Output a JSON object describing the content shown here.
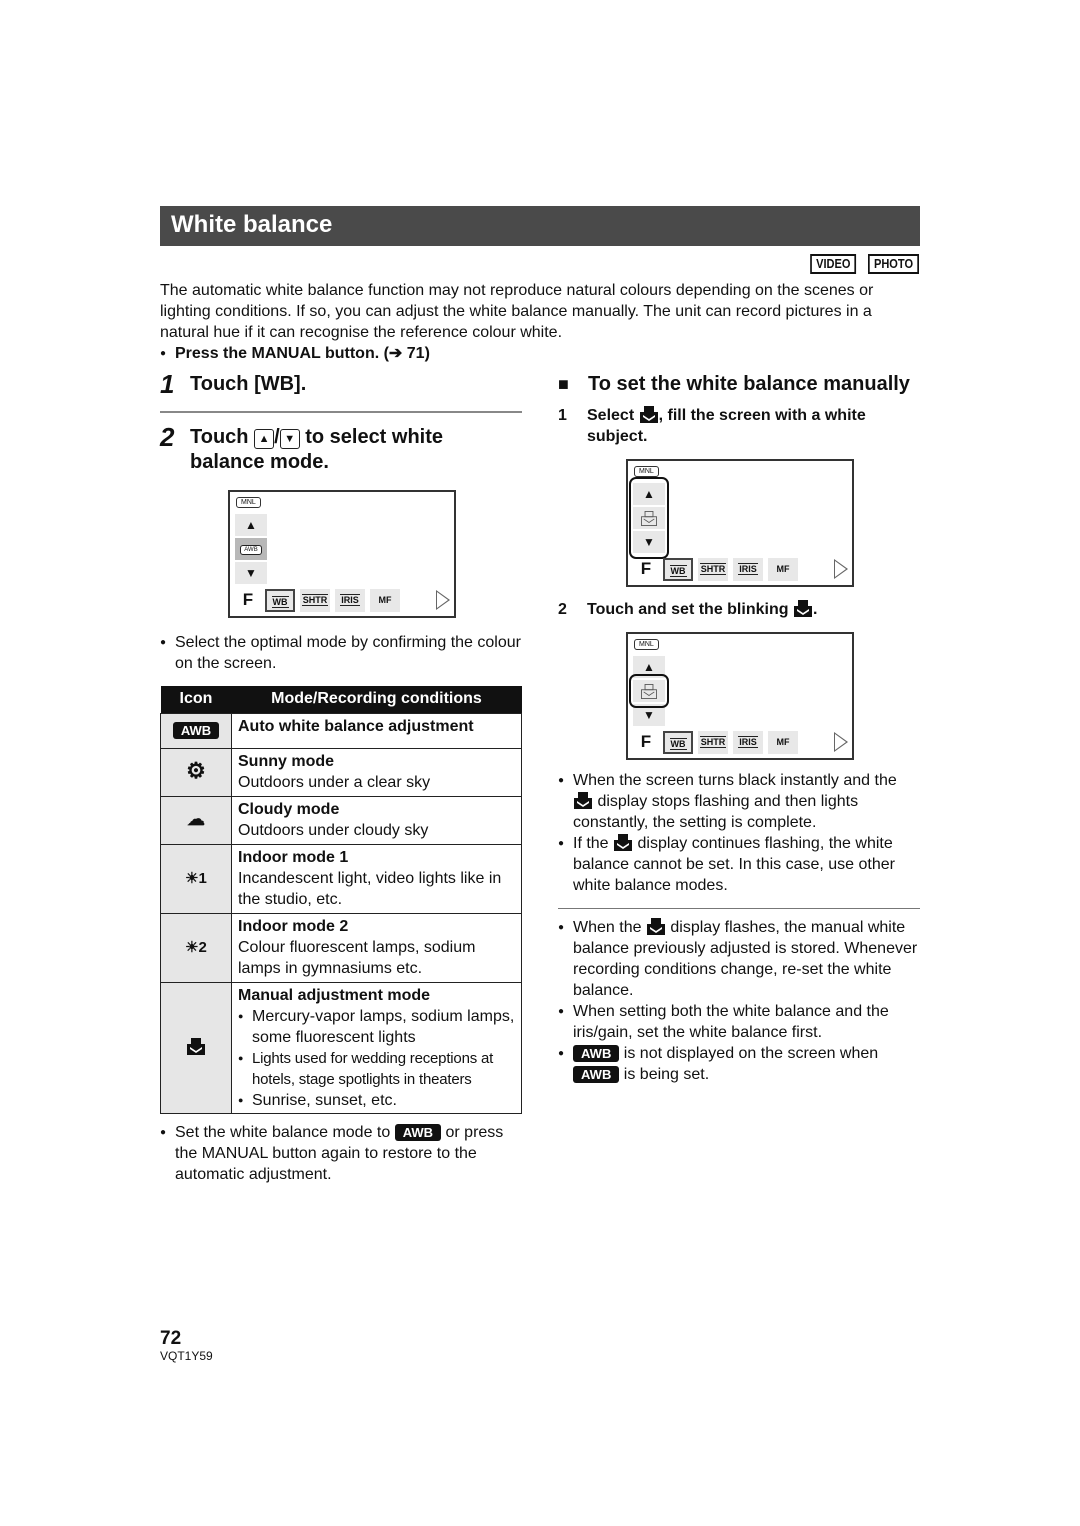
{
  "page": {
    "title": "White balance",
    "mode_badges": [
      "VIDEO",
      "PHOTO"
    ],
    "intro": "The automatic white balance function may not reproduce natural colours depending on the scenes or lighting conditions. If so, you can adjust the white balance manually. The unit can record pictures in a natural hue if it can recognise the reference colour white.",
    "press_note": "Press the MANUAL button. (➔ 71)",
    "page_number": "72",
    "doc_code": "VQT1Y59"
  },
  "left": {
    "step1": {
      "num": "1",
      "text": "Touch [WB]."
    },
    "step2": {
      "num": "2",
      "text_a": "Touch",
      "up_key": "▲",
      "slash": "/",
      "down_key": "▼",
      "text_b": "to select white balance mode."
    },
    "screen": {
      "mnl": "MNL",
      "awb": "AWB",
      "f": "F",
      "tabs": [
        "WB",
        "SHTR",
        "IRIS",
        "MF"
      ]
    },
    "note": "Select the optimal mode by confirming the colour on the screen.",
    "table": {
      "headers": [
        "Icon",
        "Mode/Recording conditions"
      ],
      "rows": [
        {
          "icon": "AWB",
          "icon_name": "awb-icon",
          "mode": "Auto white balance adjustment",
          "desc": ""
        },
        {
          "icon": "⚙",
          "icon_name": "sunny-icon",
          "mode": "Sunny mode",
          "desc": "Outdoors under a clear sky"
        },
        {
          "icon": "☁",
          "icon_name": "cloudy-icon",
          "mode": "Cloudy mode",
          "desc": "Outdoors under cloudy sky"
        },
        {
          "icon": "☀1",
          "icon_name": "indoor-1-icon",
          "mode": "Indoor mode 1",
          "desc": "Incandescent light, video lights like in the studio, etc."
        },
        {
          "icon": "☀2",
          "icon_name": "indoor-2-icon",
          "mode": "Indoor mode 2",
          "desc": "Colour fluorescent lamps, sodium lamps in gymnasiums etc."
        }
      ],
      "manual_row": {
        "mode": "Manual adjustment mode",
        "items": [
          "Mercury-vapor lamps, sodium lamps, some fluorescent lights",
          "Lights used for wedding receptions at hotels, stage spotlights in theaters",
          "Sunrise, sunset, etc."
        ]
      }
    },
    "after_note": {
      "a": "Set the white balance mode to",
      "awb": "AWB",
      "b": "or press the MANUAL button again to restore to the automatic adjustment."
    }
  },
  "right": {
    "heading": "To set the white balance manually",
    "step1": {
      "num": "1",
      "a": "Select",
      "b": ", fill the screen with a white subject."
    },
    "step2": {
      "num": "2",
      "a": "Touch and set the blinking",
      "b": "."
    },
    "screen": {
      "mnl": "MNL",
      "f": "F",
      "tabs": [
        "WB",
        "SHTR",
        "IRIS",
        "MF"
      ]
    },
    "notes1": [
      {
        "a": "When the screen turns black instantly and the",
        "b": "display stops flashing and then lights constantly, the setting is complete."
      },
      {
        "a": "If the",
        "b": "display continues flashing, the white balance cannot be set. In this case, use other white balance modes."
      }
    ],
    "notes2": {
      "n1": {
        "a": "When the",
        "b": "display flashes, the manual white balance previously adjusted is stored. Whenever recording conditions change, re-set the white balance."
      },
      "n2": "When setting both the white balance and the iris/gain, set the white balance first.",
      "n3": {
        "awb": "AWB",
        "a": "is not displayed on the screen when",
        "b": "is being set."
      }
    }
  }
}
